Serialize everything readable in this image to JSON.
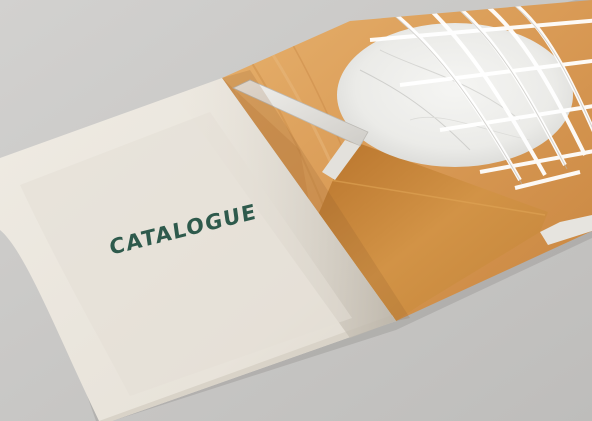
{
  "page": {
    "cover_title": "CATALOGUE"
  },
  "colors": {
    "background": "#c9c8c6",
    "paper": "#ebe6dd",
    "title": "#2e5a4c",
    "wood": "#d89a55",
    "leather": "#c98a3a",
    "marble": "#efefed"
  }
}
